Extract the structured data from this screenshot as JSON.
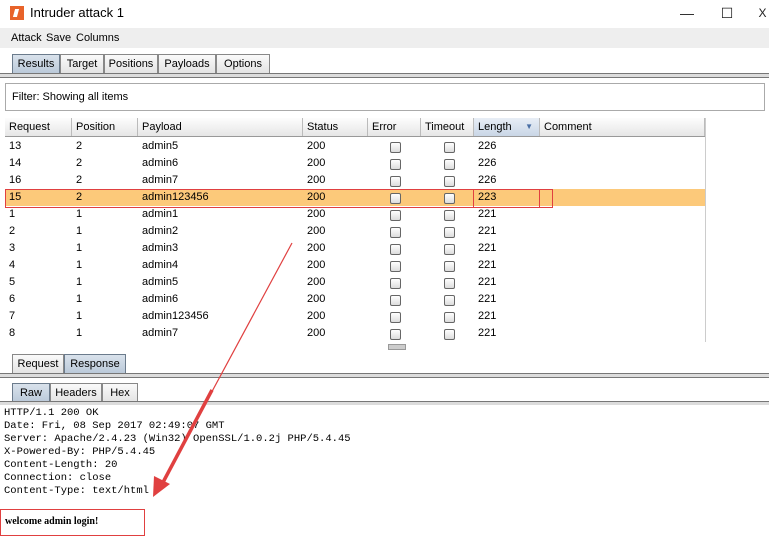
{
  "window": {
    "title": "Intruder attack 1",
    "minimize": "—",
    "maximize": "☐",
    "close": "X"
  },
  "menu": [
    "Attack",
    "Save",
    "Columns"
  ],
  "main_tabs": [
    "Results",
    "Target",
    "Positions",
    "Payloads",
    "Options"
  ],
  "filter": {
    "text": "Filter: Showing all items"
  },
  "table": {
    "columns": [
      "Request",
      "Position",
      "Payload",
      "Status",
      "Error",
      "Timeout",
      "Length",
      "Comment"
    ],
    "sorted_column": "Length",
    "rows": [
      {
        "request": "13",
        "position": "2",
        "payload": "admin5",
        "status": "200",
        "length": "226"
      },
      {
        "request": "14",
        "position": "2",
        "payload": "admin6",
        "status": "200",
        "length": "226"
      },
      {
        "request": "16",
        "position": "2",
        "payload": "admin7",
        "status": "200",
        "length": "226"
      },
      {
        "request": "15",
        "position": "2",
        "payload": "admin123456",
        "status": "200",
        "length": "223",
        "selected": true
      },
      {
        "request": "1",
        "position": "1",
        "payload": "admin1",
        "status": "200",
        "length": "221"
      },
      {
        "request": "2",
        "position": "1",
        "payload": "admin2",
        "status": "200",
        "length": "221"
      },
      {
        "request": "3",
        "position": "1",
        "payload": "admin3",
        "status": "200",
        "length": "221"
      },
      {
        "request": "4",
        "position": "1",
        "payload": "admin4",
        "status": "200",
        "length": "221"
      },
      {
        "request": "5",
        "position": "1",
        "payload": "admin5",
        "status": "200",
        "length": "221"
      },
      {
        "request": "6",
        "position": "1",
        "payload": "admin6",
        "status": "200",
        "length": "221"
      },
      {
        "request": "7",
        "position": "1",
        "payload": "admin123456",
        "status": "200",
        "length": "221"
      },
      {
        "request": "8",
        "position": "1",
        "payload": "admin7",
        "status": "200",
        "length": "221"
      }
    ]
  },
  "detail_tabs": [
    "Request",
    "Response"
  ],
  "view_tabs": [
    "Raw",
    "Headers",
    "Hex"
  ],
  "response": {
    "headers": [
      "HTTP/1.1 200 OK",
      "Date: Fri, 08 Sep 2017 02:49:07 GMT",
      "Server: Apache/2.4.23 (Win32) OpenSSL/1.0.2j PHP/5.4.45",
      "X-Powered-By: PHP/5.4.45",
      "Content-Length: 20",
      "Connection: close",
      "Content-Type: text/html"
    ],
    "body": "welcome admin login!"
  },
  "colors": {
    "selected_row": "#fcc97a",
    "annotation": "#e04040",
    "active_tab": "#b9c8d8"
  }
}
